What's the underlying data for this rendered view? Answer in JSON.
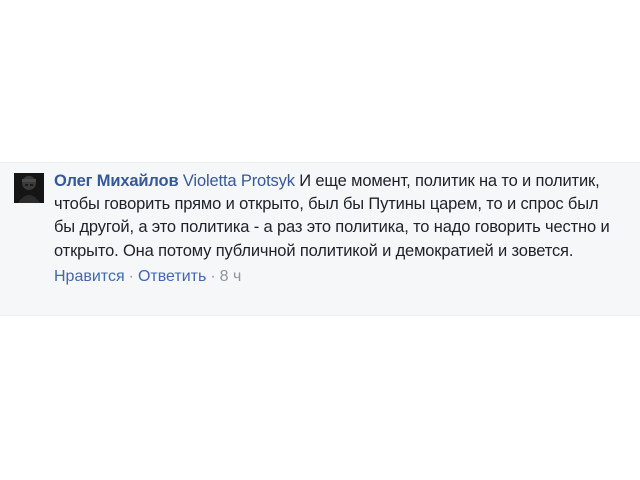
{
  "comment": {
    "author": "Олег Михайлов",
    "mention": "Violetta Protsyk",
    "text": "И еще момент, политик на то и политик, чтобы говорить прямо и открыто, был бы Путины царем, то и спрос был бы другой, а это политика - а раз это политика, то надо говорить честно и открыто. Она потому публичной политикой и демократией и зовется.",
    "actions": {
      "like_label": "Нравится",
      "reply_label": "Ответить",
      "separator": "·",
      "time": "8 ч"
    }
  },
  "colors": {
    "panel_bg": "#f6f7f9",
    "author": "#365899",
    "mention": "#365899",
    "text": "#1d2129",
    "action_link": "#4267b2",
    "meta": "#90949c"
  }
}
